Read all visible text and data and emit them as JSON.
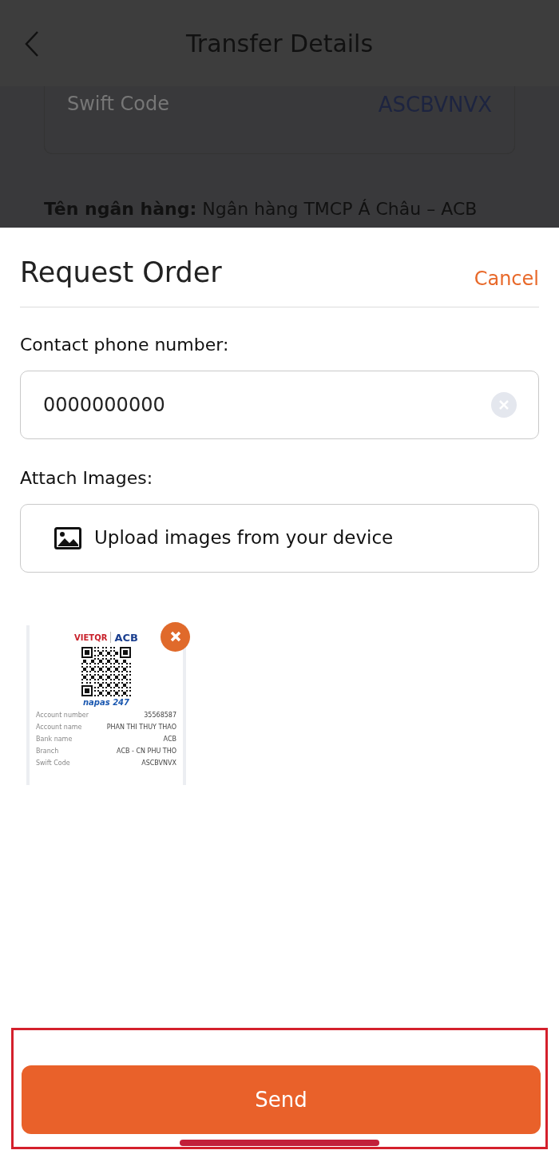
{
  "header": {
    "title": "Transfer Details"
  },
  "background": {
    "swift_label": "Swift Code",
    "swift_value": "ASCBVNVX",
    "bank_line": "**Tên ngân hàng:** Ngân hàng TMCP Á Châu – ACB"
  },
  "sheet": {
    "title": "Request Order",
    "cancel": "Cancel",
    "phone_label": "Contact phone number:",
    "phone_field": {
      "value": "0000000000"
    },
    "attach_label": "Attach Images:",
    "upload_button": "Upload images from your device",
    "attachments": [
      {
        "brand_left": "VIETQR",
        "brand_right": "ACB",
        "network": "napas 247",
        "rows": [
          {
            "label": "Account number",
            "value": "35568587"
          },
          {
            "label": "Account name",
            "value": "PHAN THI THUY THAO"
          },
          {
            "label": "Bank name",
            "value": "ACB"
          },
          {
            "label": "Branch",
            "value": "ACB - CN PHU THO"
          },
          {
            "label": "Swift Code",
            "value": "ASCBVNVX"
          }
        ]
      }
    ],
    "send_button": "Send",
    "highlighted": true
  }
}
